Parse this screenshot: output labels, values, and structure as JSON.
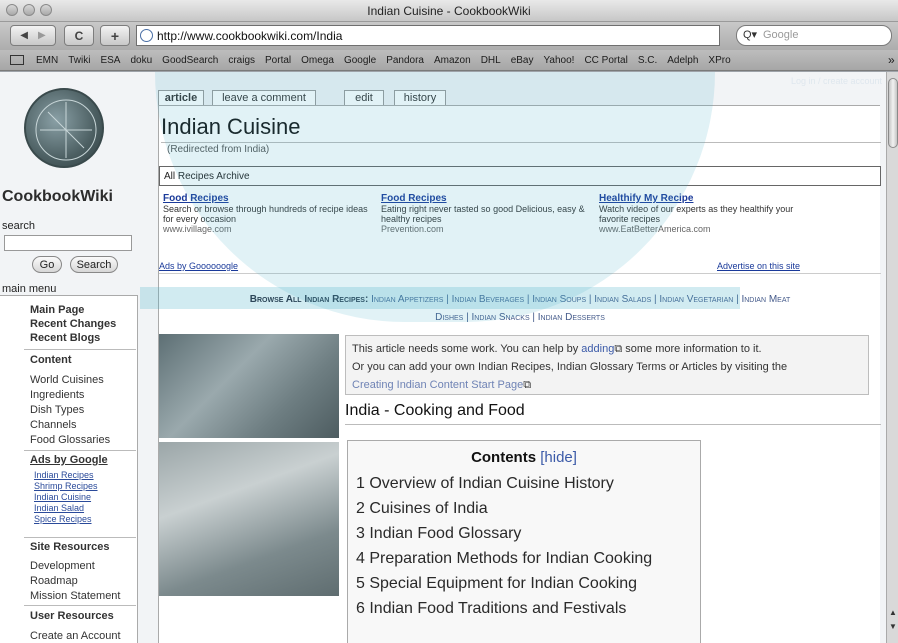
{
  "window": {
    "title": "Indian Cuisine - CookbookWiki"
  },
  "toolbar": {
    "back_icon": "back-arrow-icon",
    "forward_icon": "forward-arrow-icon",
    "reload_glyph": "C",
    "add_glyph": "+",
    "url": "http://www.cookbookwiki.com/India",
    "search_placeholder": "Google"
  },
  "bookmarks": [
    "EMN",
    "Twiki",
    "ESA",
    "doku",
    "GoodSearch",
    "craigs",
    "Portal",
    "Omega",
    "Google",
    "Pandora",
    "Amazon",
    "DHL",
    "eBay",
    "Yahoo!",
    "CC Portal",
    "S.C.",
    "Adelph",
    "XPro"
  ],
  "overflow_glyph": "»",
  "account_link": "Log in / create account",
  "sidebar": {
    "site_name": "CookbookWiki",
    "search_label": "search",
    "go_button": "Go",
    "search_button": "Search",
    "menu_heading": "main menu",
    "nav_primary": [
      "Main Page",
      "Recent Changes",
      "Recent Blogs"
    ],
    "content_heading": "Content",
    "content_items": [
      "World Cuisines",
      "Ingredients",
      "Dish Types",
      "Channels",
      "Food Glossaries"
    ],
    "ads_heading": "Ads by Google",
    "ads_links": [
      "Indian Recipes",
      "Shrimp Recipes",
      "Indian Cuisine",
      "Indian Salad",
      "Spice Recipes"
    ],
    "site_resources_heading": "Site Resources",
    "site_resources": [
      "Development",
      "Roadmap",
      "Mission Statement"
    ],
    "user_resources_heading": "User Resources",
    "user_resources": [
      "Create an Account"
    ]
  },
  "tabs": [
    "article",
    "leave a comment",
    "edit",
    "history"
  ],
  "article": {
    "title": "Indian Cuisine",
    "redirect": "(Redirected from India)",
    "archive": "All Recipes Archive",
    "ads": [
      {
        "title": "Food Recipes",
        "text": "Search or browse through hundreds of recipe ideas for every occasion",
        "url": "www.ivillage.com"
      },
      {
        "title": "Food Recipes",
        "text": "Eating right never tasted so good Delicious, easy & healthy recipes",
        "url": "Prevention.com"
      },
      {
        "title": "Healthify My Recipe",
        "text": "Watch video of our experts as they healthify your favorite recipes",
        "url": "www.EatBetterAmerica.com"
      }
    ],
    "ads_by": "Ads by Goooooogle",
    "advertise": "Advertise on this site",
    "browse_lead": "Browse All Indian Recipes:",
    "browse_line1": "Indian Appetizers | Indian Beverages | Indian Soups | Indian Salads | Indian Vegetarian | Indian Meat",
    "browse_line2": "Dishes | Indian Snacks | Indian Desserts",
    "notice": {
      "line1_before": "This article needs some work. You can help by ",
      "line1_link": "adding",
      "line1_after": " some more information to it.",
      "line2": "Or you can add your own Indian Recipes, Indian Glossary Terms or Articles by visiting the",
      "line3_link": "Creating Indian Content Start Page"
    },
    "section_title": "India - Cooking and Food",
    "toc": {
      "title": "Contents",
      "hide": "[hide]",
      "items": [
        "1 Overview of Indian Cuisine History",
        "2 Cuisines of India",
        "3 Indian Food Glossary",
        "4 Preparation Methods for Indian Cooking",
        "5 Special Equipment for Indian Cooking",
        "6 Indian Food Traditions and Festivals"
      ]
    }
  }
}
